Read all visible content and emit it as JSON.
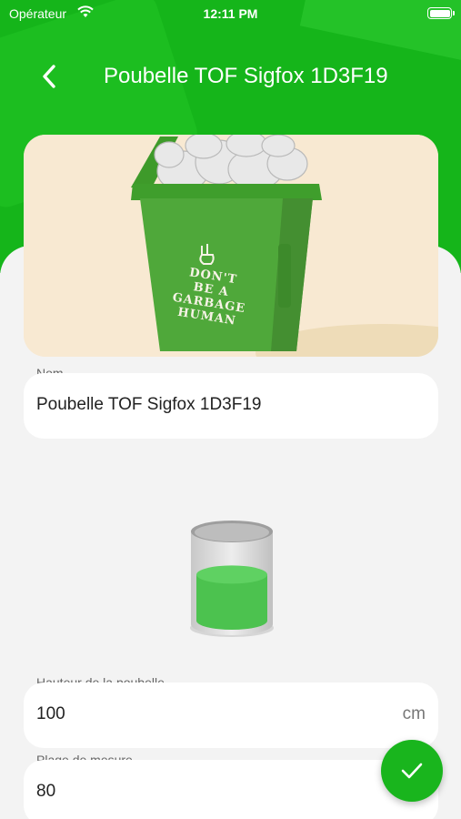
{
  "status_bar": {
    "carrier": "Opérateur",
    "time": "12:11 PM"
  },
  "header": {
    "title": "Poubelle TOF Sigfox 1D3F19",
    "back_icon": "chevron-left-icon",
    "background_color": "#15b51a"
  },
  "hero_image": {
    "bin_text_lines": [
      "DON'T",
      "BE A",
      "GARBAGE",
      "HUMAN"
    ]
  },
  "form": {
    "name": {
      "label": "Nom",
      "value": "Poubelle TOF Sigfox 1D3F19"
    },
    "fill_level": {
      "level_percent": 55,
      "color": "#4cc24f"
    },
    "bin_height": {
      "label": "Hauteur de la poubelle",
      "value": "100",
      "unit": "cm"
    },
    "measure_range": {
      "label": "Plage de mesure",
      "value": "80"
    }
  },
  "fab": {
    "icon": "check-icon",
    "color": "#19b51d"
  }
}
